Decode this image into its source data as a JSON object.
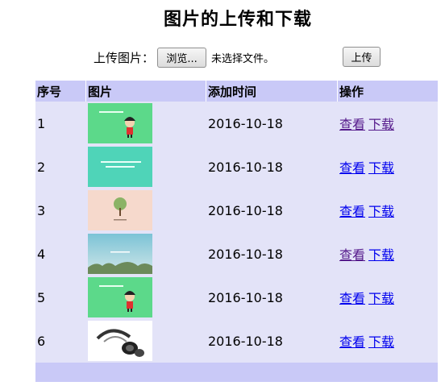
{
  "page": {
    "title": "图片的上传和下载"
  },
  "upload": {
    "label": "上传图片：",
    "browse_label": "浏览...",
    "no_file_text": "未选择文件。",
    "upload_label": "上传"
  },
  "table": {
    "headers": [
      "序号",
      "图片",
      "添加时间",
      "操作"
    ],
    "rows": [
      {
        "index": "1",
        "image": "green-cartoon-boy",
        "time": "2016-10-18",
        "view": "查看",
        "download": "下载"
      },
      {
        "index": "2",
        "image": "teal-text-card",
        "time": "2016-10-18",
        "view": "查看",
        "download": "下载"
      },
      {
        "index": "3",
        "image": "pink-tree-card",
        "time": "2016-10-18",
        "view": "查看",
        "download": "下载"
      },
      {
        "index": "4",
        "image": "sky-landscape",
        "time": "2016-10-18",
        "view": "查看",
        "download": "下载"
      },
      {
        "index": "5",
        "image": "green-cartoon-boy",
        "time": "2016-10-18",
        "view": "查看",
        "download": "下载"
      },
      {
        "index": "6",
        "image": "headphones-photo",
        "time": "2016-10-18",
        "view": "查看",
        "download": "下载"
      }
    ]
  },
  "colors": {
    "header_bg": "#c9c9f7",
    "row_bg": "#e3e3f8",
    "link": "#0000ee",
    "link_visited": "#551a8b"
  }
}
